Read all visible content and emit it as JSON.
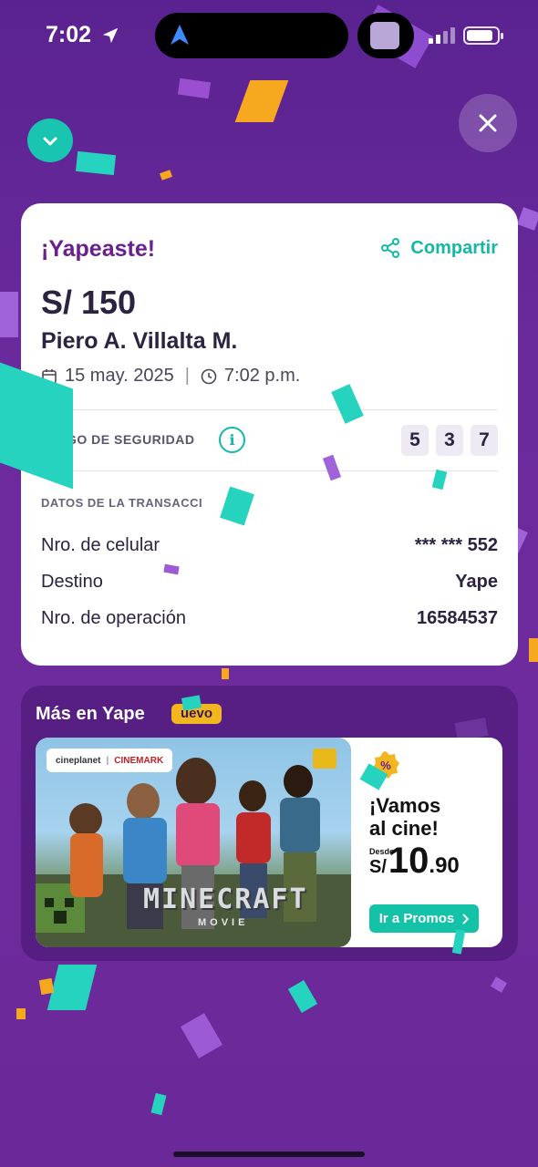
{
  "status_bar": {
    "time": "7:02"
  },
  "header": {
    "check_icon": "check-icon",
    "close_icon": "close-icon"
  },
  "receipt": {
    "title": "¡Yapeaste!",
    "share_label": "Compartir",
    "amount": "S/ 150",
    "recipient": "Piero A. Villalta M.",
    "date": "15 may. 2025",
    "time": "7:02 p.m.",
    "security_label": "GO DE SEGURIDAD",
    "security_code": [
      "5",
      "3",
      "7"
    ],
    "transaction_title": "DATOS DE LA TRANSACCI",
    "rows": [
      {
        "key": "Nro. de celular",
        "value": "*** *** 552"
      },
      {
        "key": "Destino",
        "value": "Yape"
      },
      {
        "key": "Nro. de operación",
        "value": "16584537"
      }
    ]
  },
  "promo": {
    "section_title": "Más en Yape",
    "badge": "uevo",
    "brand_left": "cineplanet",
    "brand_right": "CINEMARK",
    "movie_title": "MINECRAFT",
    "movie_subtitle": "MOVIE",
    "headline": "¡Vamos al cine!",
    "desde": "Desde",
    "currency": "S/",
    "price_whole": "10",
    "price_decimal": ".90",
    "button_label": "Ir a Promos"
  },
  "colors": {
    "brand_purple": "#6b1f8f",
    "accent_teal": "#14b8a6",
    "badge_yellow": "#f2b71e"
  }
}
